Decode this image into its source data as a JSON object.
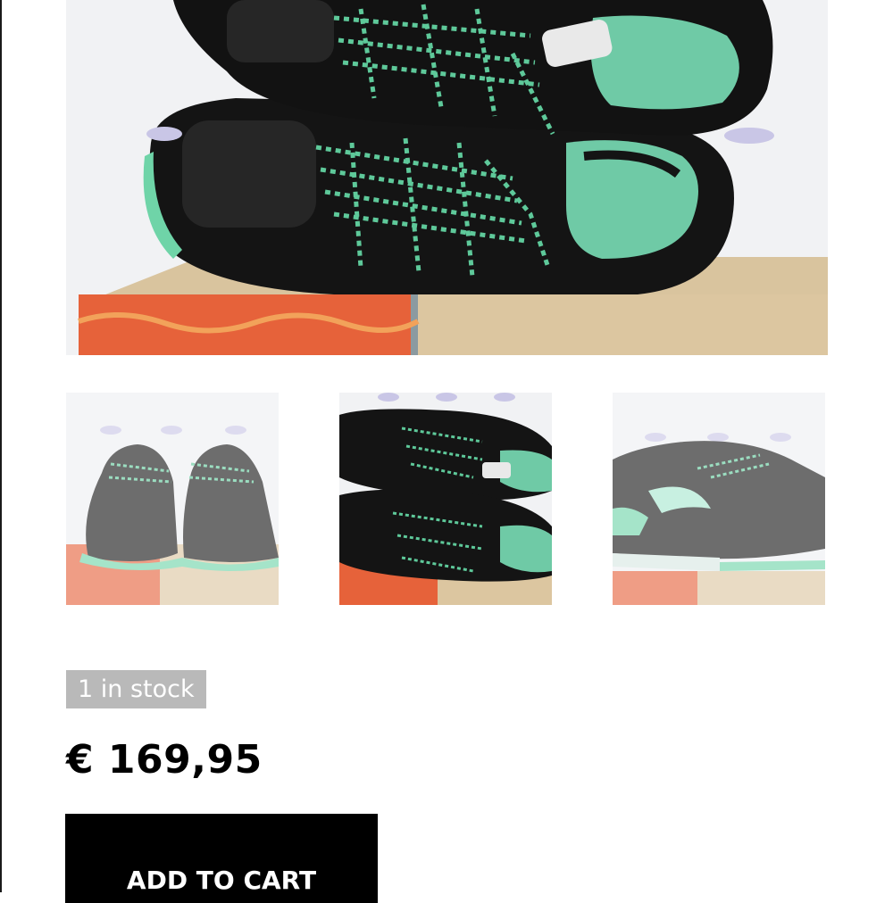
{
  "product": {
    "stock_label": "1 in stock",
    "price": "€ 169,95",
    "add_to_cart_label": "ADD TO CART"
  },
  "gallery": {
    "main_image_subject": "sneakers-stacked-top-view",
    "thumbnails": [
      {
        "subject": "sneakers-rear-view"
      },
      {
        "subject": "sneakers-stacked-top-view"
      },
      {
        "subject": "sneakers-side-view"
      }
    ]
  },
  "colors": {
    "shoe_black": "#141414",
    "mint_accent": "#6fd4a8",
    "box_orange": "#e6623a",
    "box_cardboard": "#d8c29c",
    "stock_badge_bg": "#b9b9b9",
    "button_bg": "#000000"
  }
}
